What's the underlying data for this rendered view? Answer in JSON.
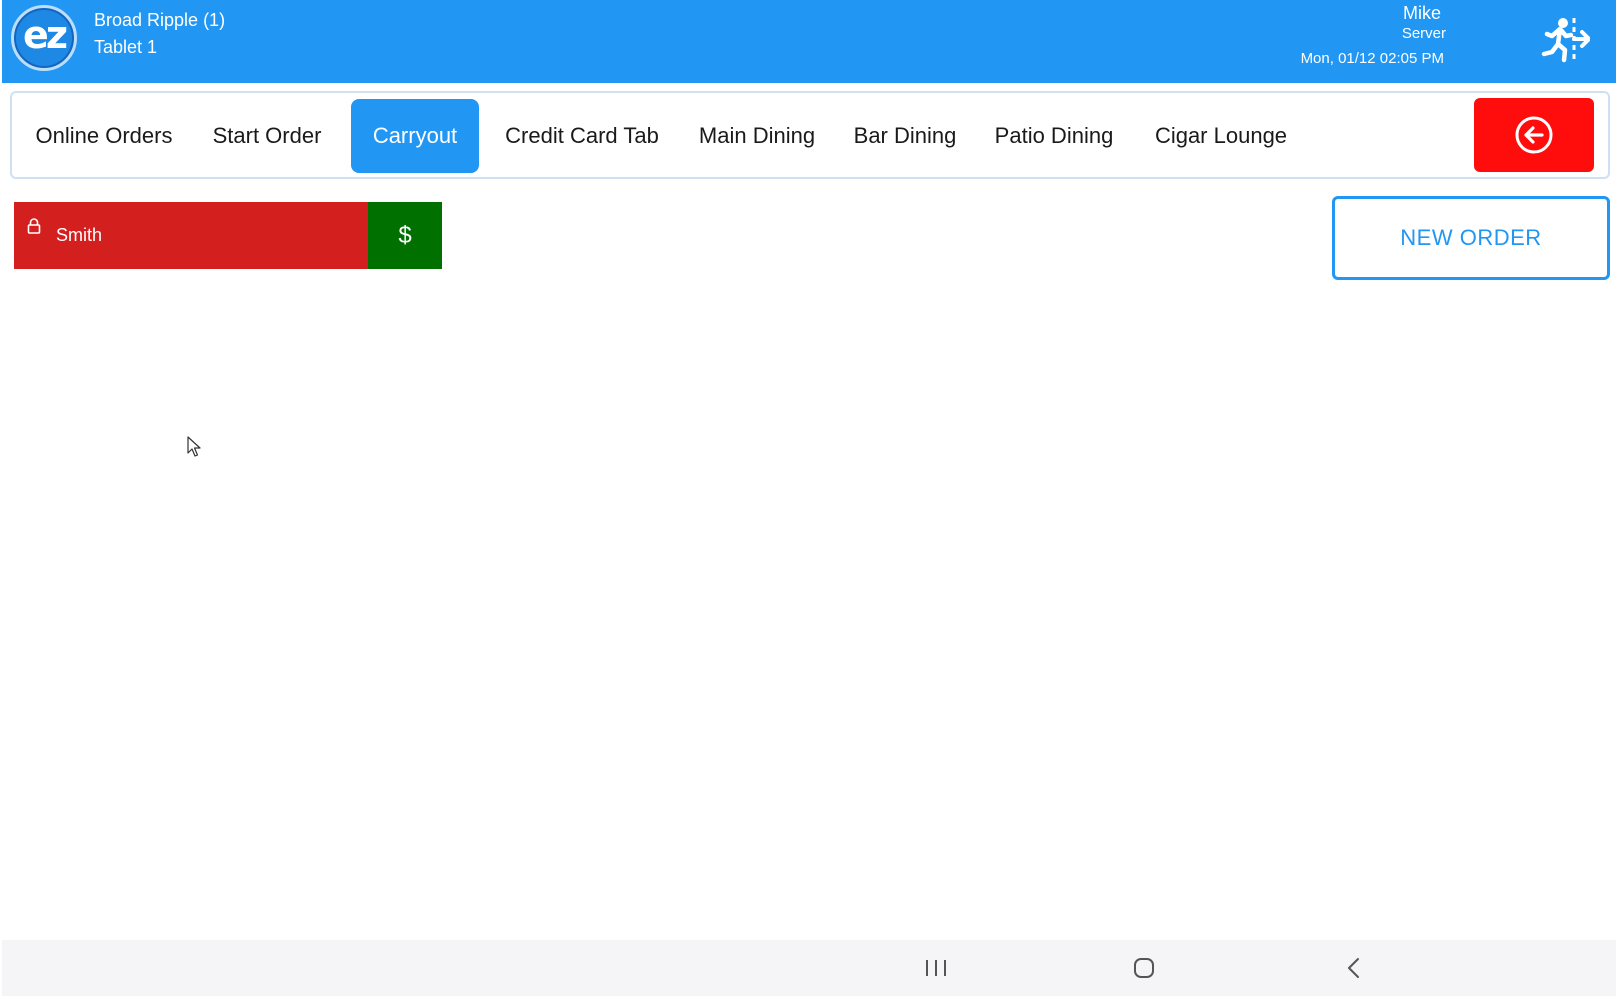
{
  "header": {
    "logo_text": "ez",
    "store_name": "Broad Ripple (1)",
    "device_name": "Tablet 1",
    "user_name": "Mike",
    "user_role": "Server",
    "datetime": "Mon, 01/12 02:05 PM"
  },
  "tabs": [
    {
      "label": "Online Orders",
      "active": false
    },
    {
      "label": "Start Order",
      "active": false
    },
    {
      "label": "Carryout",
      "active": true
    },
    {
      "label": "Credit Card Tab",
      "active": false
    },
    {
      "label": "Main Dining",
      "active": false
    },
    {
      "label": "Bar Dining",
      "active": false
    },
    {
      "label": "Patio Dining",
      "active": false
    },
    {
      "label": "Cigar Lounge",
      "active": false
    }
  ],
  "orders": [
    {
      "name": "Smith",
      "locked": true,
      "pay_label": "$"
    }
  ],
  "actions": {
    "new_order_label": "NEW ORDER"
  },
  "colors": {
    "primary": "#2196f3",
    "danger": "#ff0d0d",
    "order_red": "#d41f1f",
    "pay_green": "#007000"
  },
  "icons": {
    "logout": "exit-run-icon",
    "back": "arrow-left-circle-icon",
    "lock": "lock-icon"
  }
}
